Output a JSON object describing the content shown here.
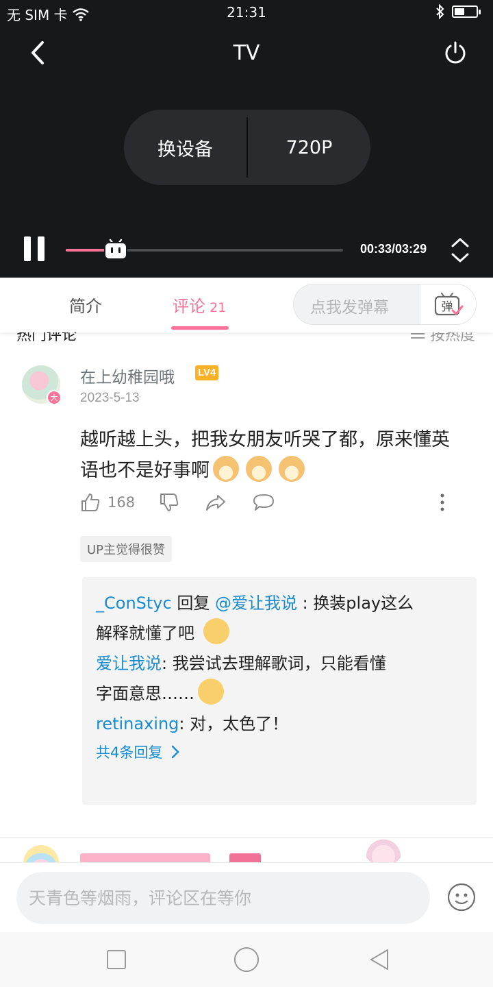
{
  "status_bar": {
    "carrier": "无 SIM 卡",
    "time": "21:31"
  },
  "player": {
    "title": "TV",
    "switch_device_label": "换设备",
    "quality_label": "720P",
    "current_time": "00:33",
    "duration": "03:29",
    "time_display": "00:33/03:29",
    "progress_fraction": 0.158,
    "accent_color": "#fb7299"
  },
  "tabs": {
    "intro_label": "简介",
    "comments_label": "评论",
    "comments_count": "21",
    "danmaku_placeholder": "点我发弹幕",
    "danmaku_icon_text": "弹"
  },
  "comments_header": {
    "title": "热门评论",
    "sort_label": "按热度"
  },
  "comment": {
    "username": "在上幼稚园哦",
    "level": "LV4",
    "avatar_badge": "大",
    "date": "2023-5-13",
    "text_line1": "越听越上头，把我女朋友听哭了都，原来懂英",
    "text_line2": "语也不是好事啊",
    "emojis": [
      "doge-icon",
      "doge-icon",
      "doge-icon"
    ],
    "likes": "168",
    "up_tag": "UP主觉得很赞",
    "replies": [
      {
        "user": "_ConStyc",
        "connector": " 回复 ",
        "target": "@爱让我说",
        "text_line1": " : 换装play这么",
        "text_line2": "解释就懂了吧"
      },
      {
        "user": "爱让我说",
        "text_line1": ": 我尝试去理解歌词，只能看懂",
        "text_line2": "字面意思……"
      },
      {
        "user": "retinaxing",
        "text_line1": ": 对，太色了！"
      }
    ],
    "more_replies_label": "共4条回复",
    "link_color": "#178bcf"
  },
  "input_bar": {
    "placeholder": "天青色等烟雨，评论区在等你"
  }
}
